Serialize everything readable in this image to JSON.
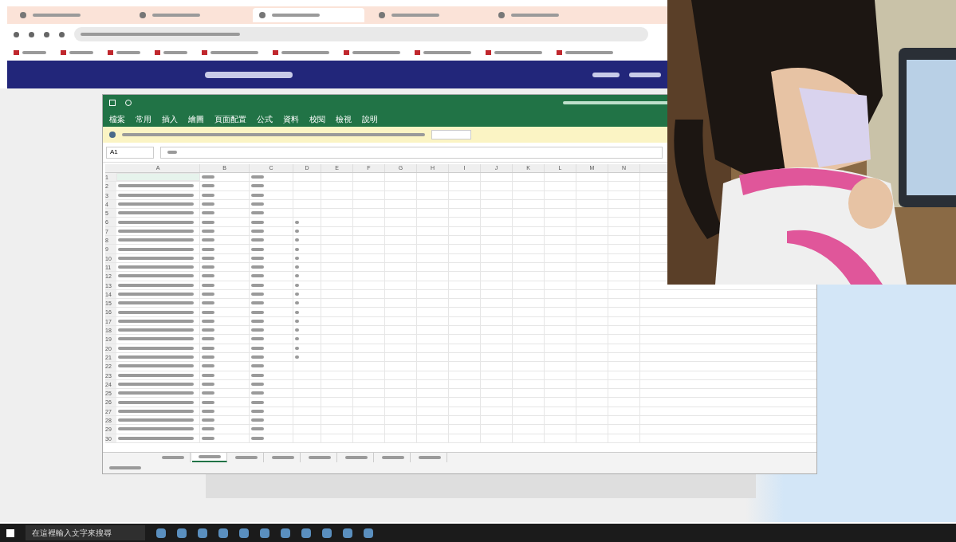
{
  "spreadsheet": {
    "ribbon_tabs": [
      "檔案",
      "常用",
      "插入",
      "繪圖",
      "頁面配置",
      "公式",
      "資料",
      "校閱",
      "檢視",
      "說明"
    ],
    "name_box": "A1",
    "columns": [
      "A",
      "B",
      "C",
      "D",
      "E",
      "F",
      "G",
      "H",
      "I",
      "J",
      "K",
      "L",
      "M",
      "N"
    ],
    "rows": [
      "1",
      "2",
      "3",
      "4",
      "5",
      "6",
      "7",
      "8",
      "9",
      "10",
      "11",
      "12",
      "13",
      "14",
      "15",
      "16",
      "17",
      "18",
      "19",
      "20",
      "21",
      "22",
      "23",
      "24",
      "25",
      "26",
      "27",
      "28",
      "29",
      "30"
    ],
    "sheet_tabs": [
      {
        "selected": false
      },
      {
        "selected": true
      },
      {
        "selected": false
      },
      {
        "selected": false
      },
      {
        "selected": false
      },
      {
        "selected": false
      },
      {
        "selected": false
      },
      {
        "selected": false
      }
    ]
  },
  "browser_tabs": [
    {
      "selected": false
    },
    {
      "selected": false
    },
    {
      "selected": true
    },
    {
      "selected": false
    },
    {
      "selected": false
    }
  ],
  "taskbar": {
    "search_placeholder": "在這裡輸入文字來搜尋"
  }
}
